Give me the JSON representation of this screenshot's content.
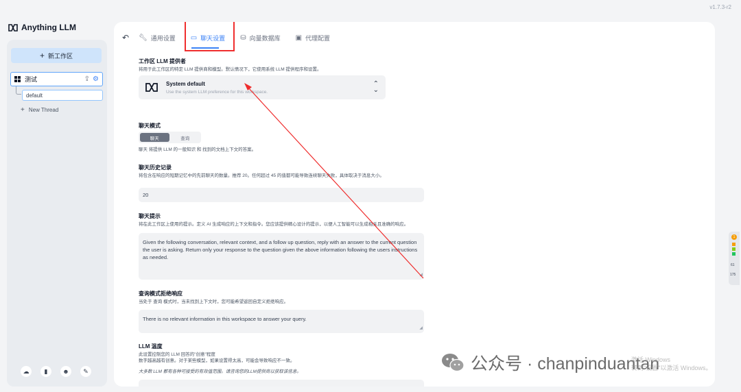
{
  "app": {
    "version": "v1.7.3-r2",
    "brand_name": "Anything LLM"
  },
  "sidebar": {
    "new_workspace_label": "新工作区",
    "workspace": {
      "name": "测试",
      "upload_icon": "upload-icon",
      "settings_icon": "gear-icon"
    },
    "thread_default": "default",
    "new_thread_label": "New Thread",
    "footer_icons": [
      "community-icon",
      "book-icon",
      "discord-icon",
      "wrench-icon"
    ]
  },
  "tabs": {
    "back_icon": "back-arrow-icon",
    "items": [
      {
        "label": "通用设置",
        "icon": "wrench-icon"
      },
      {
        "label": "聊天设置",
        "icon": "chat-icon",
        "active": true
      },
      {
        "label": "向量数据库",
        "icon": "database-icon"
      },
      {
        "label": "代理配置",
        "icon": "agent-icon"
      }
    ]
  },
  "sections": {
    "llm_provider": {
      "title": "工作区 LLM 提供者",
      "desc": "将用于此工作区的特定 LLM 提供商和模型。默认情况下，它使用系统 LLM 提供程序和设置。",
      "selected_name": "System default",
      "selected_desc": "Use the system LLM preference for this workspace."
    },
    "chat_mode": {
      "title": "聊天模式",
      "options": [
        "聊天",
        "查询"
      ],
      "selected": "聊天",
      "desc": "聊天 将提供 LLM 的一般知识 和 找到的文档上下文的答案。"
    },
    "chat_history": {
      "title": "聊天历史记录",
      "desc": "将包含在响应的短期记忆中的先前聊天的数量。推荐 20。任何超过 45 的值都可能导致连续聊天失败，具体取决于消息大小。",
      "value": "20"
    },
    "prompt": {
      "title": "聊天提示",
      "desc": "将在此工作区上使用的提示。定义 AI 生成响应的上下文和指令。您应该提供精心设计的提示，以便人工智能可以生成相关且准确的响应。",
      "value": "Given the following conversation, relevant context, and a follow up question, reply with an answer to the current question the user is asking. Return only your response to the question given the above information following the users instructions as needed."
    },
    "refusal": {
      "title": "查询模式拒绝响应",
      "desc": "当处于 查询 模式时，当未找到上下文时，您可能希望返回自定义拒绝响应。",
      "value": "There is no relevant information in this workspace to answer your query."
    },
    "temperature": {
      "title": "LLM 温度",
      "desc1": "此设置控制您的 LLM 回答的\"创意\"程度",
      "desc2": "数字越高越有创意。对于某些模型，如果设置得太高，可能会导致响应不一致。",
      "note": "大多数 LLM 都有各种可接受的有效值范围。请咨询您的LLM提供商以获取该信息。"
    }
  },
  "watermark": {
    "text": "公众号 · chanpinduantan",
    "windows_line1": "激活 Windows",
    "windows_line2": "转到\"设置\"以激活 Windows。"
  },
  "side_widget": {
    "badge": "1",
    "value1": "61",
    "value2": "175"
  },
  "colors": {
    "accent": "#3b82f6",
    "highlight_red": "#ef2d2d"
  }
}
